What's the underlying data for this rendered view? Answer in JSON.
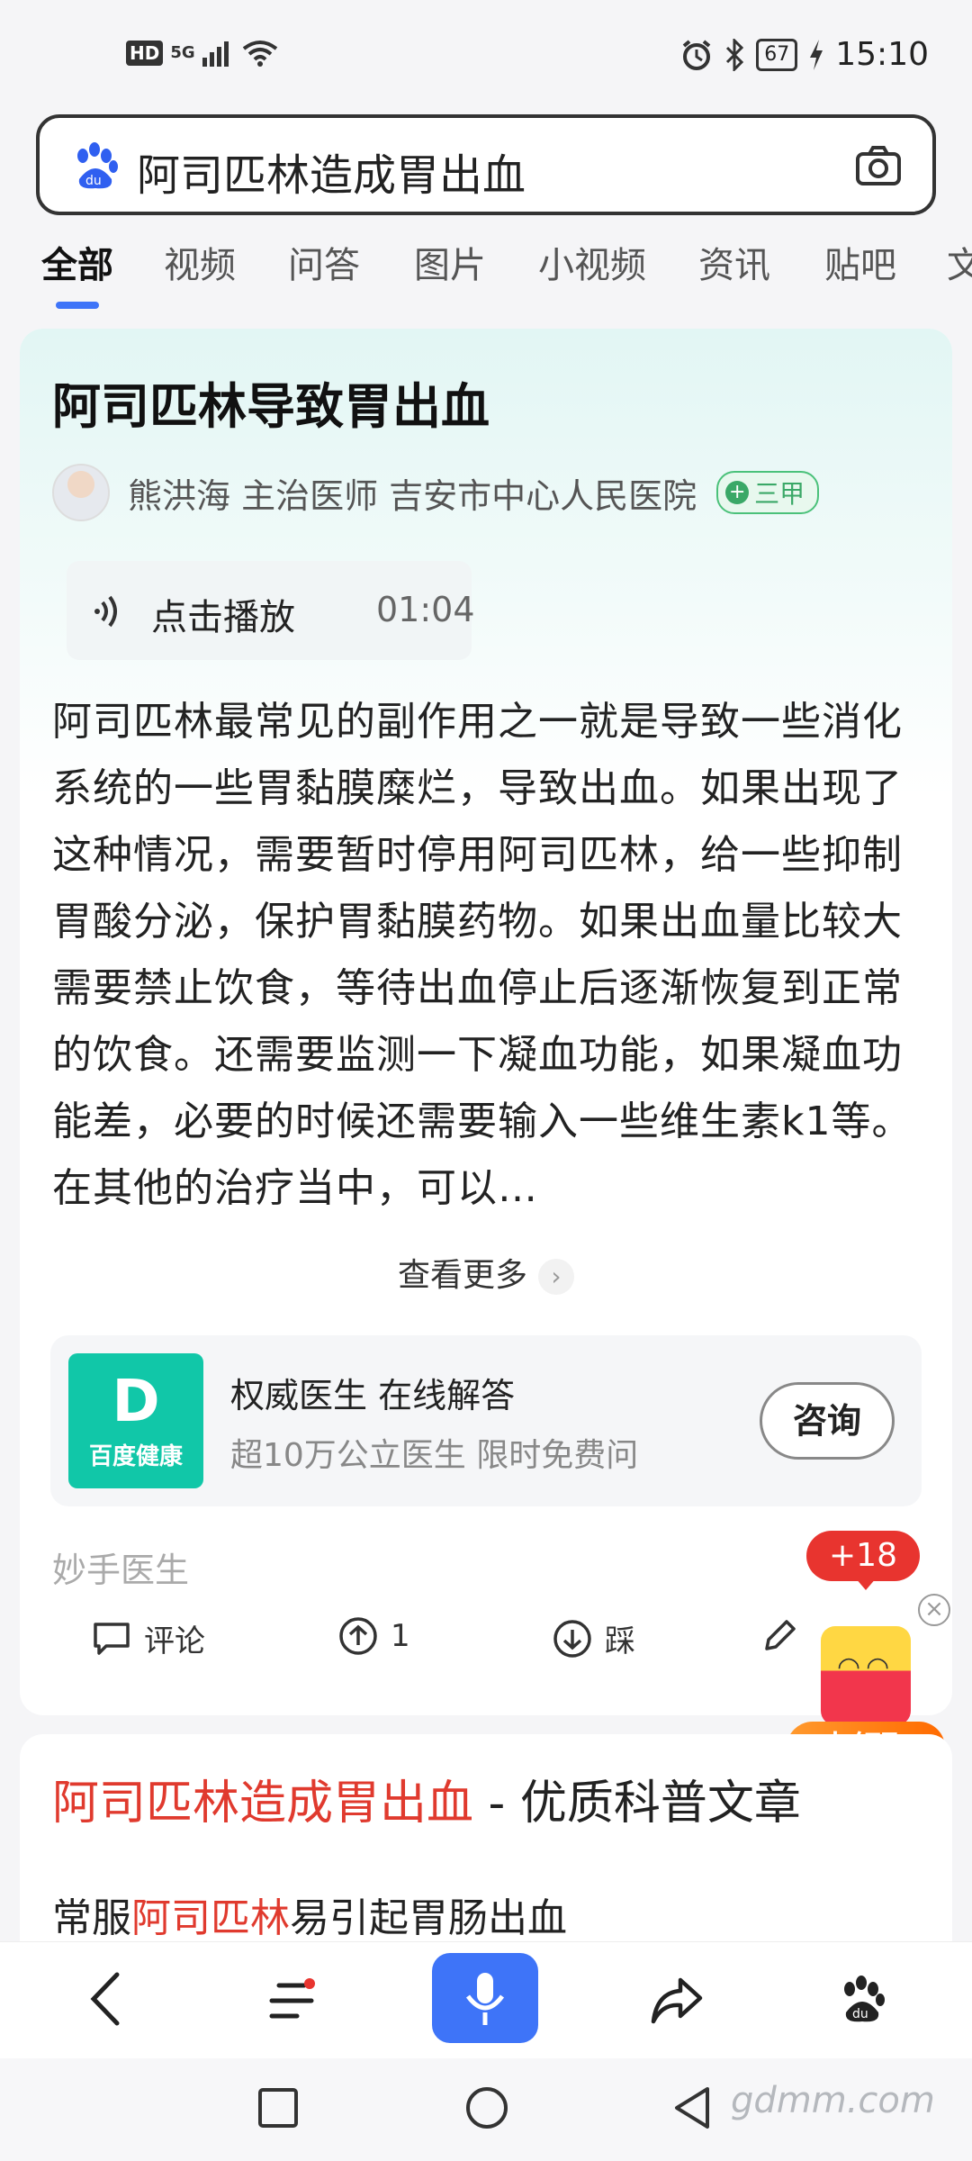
{
  "status_bar": {
    "hd": "HD",
    "network": "5G",
    "battery": "67",
    "time": "15:10"
  },
  "search": {
    "query": "阿司匹林造成胃出血"
  },
  "tabs": [
    "全部",
    "视频",
    "问答",
    "图片",
    "小视频",
    "资讯",
    "贴吧",
    "文"
  ],
  "result1": {
    "title": "阿司匹林导致胃出血",
    "doctor": "熊洪海 主治医师 吉安市中心人民医院",
    "hospital_badge": "三甲",
    "audio_label": "点击播放",
    "audio_duration": "01:04",
    "body": "阿司匹林最常见的副作用之一就是导致一些消化系统的一些胃黏膜糜烂，导致出血。如果出现了这种情况，需要暂时停用阿司匹林，给一些抑制胃酸分泌，保护胃黏膜药物。如果出血量比较大需要禁止饮食，等待出血停止后逐渐恢复到正常的饮食。还需要监测一下凝血功能，如果凝血功能差，必要的时候还需要输入一些维生素k1等。在其他的治疗当中，可以…",
    "see_more": "查看更多",
    "ad": {
      "logo_text": "百度健康",
      "title": "权威医生 在线解答",
      "subtitle": "超10万公立医生 限时免费问",
      "button": "咨询"
    },
    "source": "妙手医生",
    "actions": {
      "comment": "评论",
      "upvote_count": "1",
      "downvote": "踩"
    }
  },
  "floating": {
    "badge": "+18",
    "close": "×",
    "button": "去领取"
  },
  "result2": {
    "title_highlight": "阿司匹林造成胃出血",
    "title_rest": " - 优质科普文章",
    "snippet_pre": "常服",
    "snippet_highlight": "阿司匹林",
    "snippet_post": "易引起胃肠出血"
  },
  "watermark": "gdmm.com",
  "colors": {
    "accent_blue": "#3e74f8",
    "highlight_red": "#e03a2e",
    "health_green": "#11c7a8"
  }
}
